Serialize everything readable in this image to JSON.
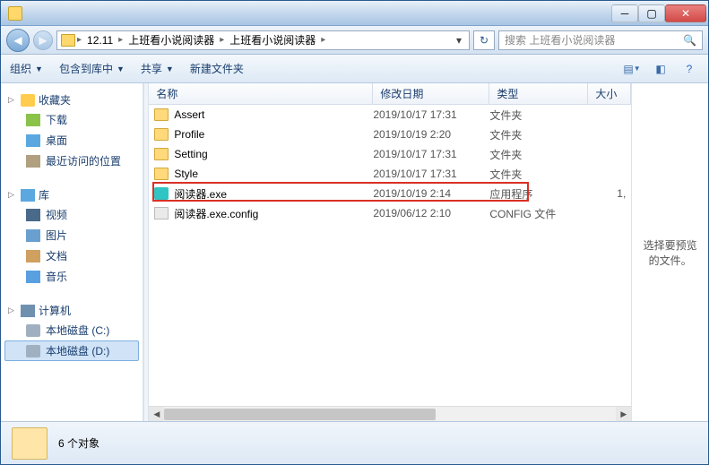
{
  "breadcrumb": {
    "segments": [
      "12.11",
      "上班看小说阅读器",
      "上班看小说阅读器"
    ]
  },
  "search": {
    "placeholder": "搜索 上班看小说阅读器"
  },
  "toolbar": {
    "organize": "组织",
    "include": "包含到库中",
    "share": "共享",
    "new_folder": "新建文件夹"
  },
  "sidebar": {
    "favorites": {
      "label": "收藏夹",
      "items": [
        {
          "label": "下载",
          "icon": "dl"
        },
        {
          "label": "桌面",
          "icon": "desk"
        },
        {
          "label": "最近访问的位置",
          "icon": "recent"
        }
      ]
    },
    "libraries": {
      "label": "库",
      "items": [
        {
          "label": "视频",
          "icon": "vid"
        },
        {
          "label": "图片",
          "icon": "pic"
        },
        {
          "label": "文档",
          "icon": "doc"
        },
        {
          "label": "音乐",
          "icon": "mus"
        }
      ]
    },
    "computer": {
      "label": "计算机",
      "items": [
        {
          "label": "本地磁盘 (C:)",
          "icon": "diskc"
        },
        {
          "label": "本地磁盘 (D:)",
          "icon": "diskd",
          "selected": true
        }
      ]
    }
  },
  "columns": {
    "name": "名称",
    "date": "修改日期",
    "type": "类型",
    "size": "大小"
  },
  "files": [
    {
      "name": "Assert",
      "date": "2019/10/17 17:31",
      "type": "文件夹",
      "size": "",
      "icon": "folder"
    },
    {
      "name": "Profile",
      "date": "2019/10/19 2:20",
      "type": "文件夹",
      "size": "",
      "icon": "folder"
    },
    {
      "name": "Setting",
      "date": "2019/10/17 17:31",
      "type": "文件夹",
      "size": "",
      "icon": "folder"
    },
    {
      "name": "Style",
      "date": "2019/10/17 17:31",
      "type": "文件夹",
      "size": "",
      "icon": "folder"
    },
    {
      "name": "阅读器.exe",
      "date": "2019/10/19 2:14",
      "type": "应用程序",
      "size": "1,",
      "icon": "exe"
    },
    {
      "name": "阅读器.exe.config",
      "date": "2019/06/12 2:10",
      "type": "CONFIG 文件",
      "size": "",
      "icon": "cfg"
    }
  ],
  "preview": {
    "empty_text": "选择要预览的文件。"
  },
  "status": {
    "count_text": "6 个对象"
  }
}
